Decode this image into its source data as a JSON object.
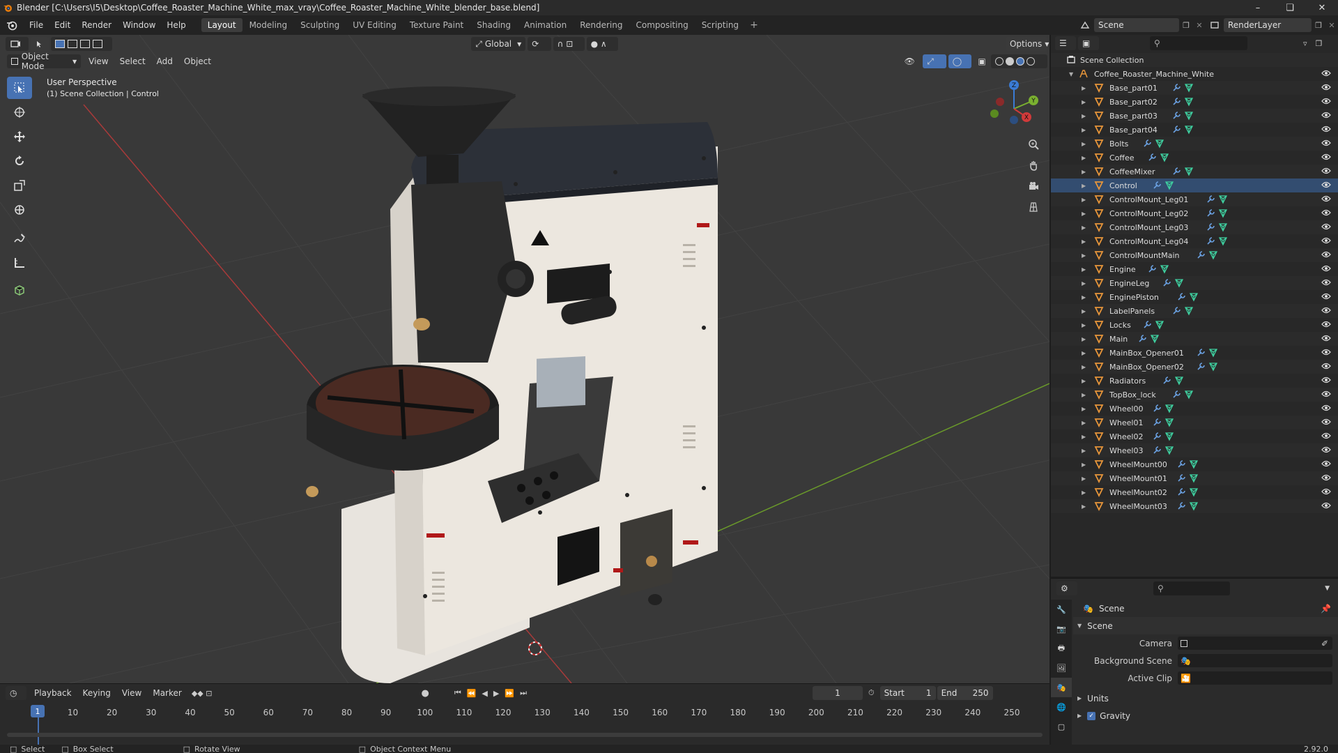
{
  "window": {
    "title": "Blender [C:\\Users\\I5\\Desktop\\Coffee_Roaster_Machine_White_max_vray\\Coffee_Roaster_Machine_White_blender_base.blend]"
  },
  "menus": [
    "File",
    "Edit",
    "Render",
    "Window",
    "Help"
  ],
  "workspaces": [
    "Layout",
    "Modeling",
    "Sculpting",
    "UV Editing",
    "Texture Paint",
    "Shading",
    "Animation",
    "Rendering",
    "Compositing",
    "Scripting"
  ],
  "active_workspace": "Layout",
  "scene_selector": "Scene",
  "view_layer_selector": "RenderLayer",
  "viewport": {
    "mode": "Object Mode",
    "menus": [
      "View",
      "Select",
      "Add",
      "Object"
    ],
    "transform_orientation": "Global",
    "options_label": "Options",
    "overlay_line1": "User Perspective",
    "overlay_line2": "(1) Scene Collection | Control",
    "gizmo_axes": {
      "x": "X",
      "y": "Y",
      "z": "Z"
    }
  },
  "timeline": {
    "menus": [
      "Playback",
      "Keying",
      "View",
      "Marker"
    ],
    "current_frame": "1",
    "start_label": "Start",
    "start_value": "1",
    "end_label": "End",
    "end_value": "250",
    "ticks": [
      "10",
      "20",
      "30",
      "40",
      "50",
      "60",
      "70",
      "80",
      "90",
      "100",
      "110",
      "120",
      "130",
      "140",
      "150",
      "160",
      "170",
      "180",
      "190",
      "200",
      "210",
      "220",
      "230",
      "240",
      "250"
    ],
    "playhead_label": "1"
  },
  "statusbar": {
    "select": "Select",
    "box_select": "Box Select",
    "rotate_view": "Rotate View",
    "context_menu": "Object Context Menu",
    "version": "2.92.0"
  },
  "outliner": {
    "root": "Scene Collection",
    "collection": "Coffee_Roaster_Machine_White",
    "objects": [
      {
        "name": "Base_part01",
        "mods": 2
      },
      {
        "name": "Base_part02",
        "mods": 2
      },
      {
        "name": "Base_part03",
        "mods": 2
      },
      {
        "name": "Base_part04",
        "mods": 2
      },
      {
        "name": "Bolts",
        "mods": 2
      },
      {
        "name": "Coffee",
        "mods": 2
      },
      {
        "name": "CoffeeMixer",
        "mods": 2
      },
      {
        "name": "Control",
        "mods": 2
      },
      {
        "name": "ControlMount_Leg01",
        "mods": 2
      },
      {
        "name": "ControlMount_Leg02",
        "mods": 2
      },
      {
        "name": "ControlMount_Leg03",
        "mods": 2
      },
      {
        "name": "ControlMount_Leg04",
        "mods": 2
      },
      {
        "name": "ControlMountMain",
        "mods": 2
      },
      {
        "name": "Engine",
        "mods": 2
      },
      {
        "name": "EngineLeg",
        "mods": 2
      },
      {
        "name": "EnginePiston",
        "mods": 2
      },
      {
        "name": "LabelPanels",
        "mods": 2
      },
      {
        "name": "Locks",
        "mods": 2
      },
      {
        "name": "Main",
        "mods": 2
      },
      {
        "name": "MainBox_Opener01",
        "mods": 2
      },
      {
        "name": "MainBox_Opener02",
        "mods": 2
      },
      {
        "name": "Radiators",
        "mods": 2
      },
      {
        "name": "TopBox_lock",
        "mods": 2
      },
      {
        "name": "Wheel00",
        "mods": 2
      },
      {
        "name": "Wheel01",
        "mods": 2
      },
      {
        "name": "Wheel02",
        "mods": 2
      },
      {
        "name": "Wheel03",
        "mods": 2
      },
      {
        "name": "WheelMount00",
        "mods": 2
      },
      {
        "name": "WheelMount01",
        "mods": 2
      },
      {
        "name": "WheelMount02",
        "mods": 2
      },
      {
        "name": "WheelMount03",
        "mods": 2
      }
    ]
  },
  "properties": {
    "context": "Scene",
    "panel_scene": "Scene",
    "camera_label": "Camera",
    "background_scene_label": "Background Scene",
    "active_clip_label": "Active Clip",
    "units_label": "Units",
    "gravity_label": "Gravity"
  },
  "colors": {
    "accent": "#4772b3",
    "object_icon": "#e8963a",
    "modifier_icon": "#6aa0e0",
    "mesh_icon": "#3fd0a0"
  }
}
